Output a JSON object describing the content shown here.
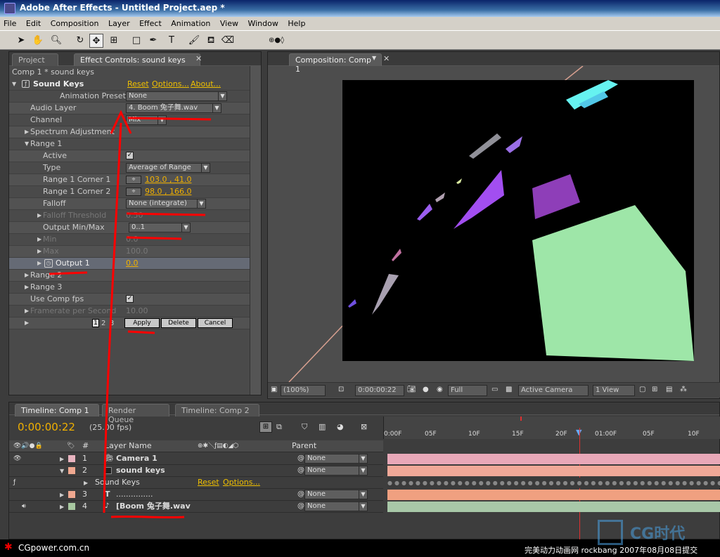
{
  "window": {
    "title": "Adobe After Effects - Untitled Project.aep *"
  },
  "menu": [
    "File",
    "Edit",
    "Composition",
    "Layer",
    "Effect",
    "Animation",
    "View",
    "Window",
    "Help"
  ],
  "left_panel": {
    "tabs": [
      "Project",
      "Effect Controls: sound keys"
    ],
    "breadcrumb": "Comp 1 * sound keys",
    "effect_name": "Sound Keys",
    "reset": "Reset",
    "options": "Options...",
    "about": "About...",
    "rows": [
      {
        "label": "Animation Presets:",
        "value": "None"
      },
      {
        "label": "Audio Layer",
        "value": "4. Boom 兔子舞.wav"
      },
      {
        "label": "Channel",
        "value": "Mix"
      },
      {
        "label": "Spectrum Adjustment",
        "value": ""
      },
      {
        "label": "Range 1",
        "value": ""
      },
      {
        "label": "Active",
        "value": "✓"
      },
      {
        "label": "Type",
        "value": "Average of Range"
      },
      {
        "label": "Range 1 Corner 1",
        "value": "103.0 , 41.0"
      },
      {
        "label": "Range 1 Corner 2",
        "value": "98.0 , 166.0"
      },
      {
        "label": "Falloff",
        "value": "None (integrate)"
      },
      {
        "label": "Falloff Threshold",
        "value": "0.50"
      },
      {
        "label": "Output Min/Max",
        "value": "0..1"
      },
      {
        "label": "Min",
        "value": "0.0"
      },
      {
        "label": "Max",
        "value": "100.0"
      },
      {
        "label": "Output 1",
        "value": "0.0"
      },
      {
        "label": "Range 2",
        "value": ""
      },
      {
        "label": "Range 3",
        "value": ""
      },
      {
        "label": "Use Comp fps",
        "value": "✓"
      },
      {
        "label": "Framerate per Second",
        "value": "10.00"
      }
    ],
    "pages": [
      "1",
      "2",
      "3"
    ],
    "buttons": {
      "apply": "Apply",
      "delete": "Delete",
      "cancel": "Cancel"
    }
  },
  "comp_panel": {
    "tab": "Composition: Comp 1",
    "zoom": "(100%)",
    "timecode": "0:00:00:22",
    "resolution": "Full",
    "camera": "Active Camera",
    "view": "1 View"
  },
  "timeline": {
    "tabs": [
      "Timeline: Comp 1",
      "Render Queue",
      "Timeline: Comp 2"
    ],
    "timecode": "0:00:00:22",
    "fps": "(25.00 fps)",
    "ruler": [
      "0:00F",
      "05F",
      "10F",
      "15F",
      "20F",
      "01:00F",
      "05F",
      "10F"
    ],
    "col_hash": "#",
    "col_layer_name": "Layer Name",
    "col_parent": "Parent",
    "layers": [
      {
        "num": "1",
        "name": "Camera 1",
        "parent": "None",
        "color": "#e8b4c0"
      },
      {
        "num": "2",
        "name": "sound keys",
        "parent": "None",
        "color": "#f0a890"
      },
      {
        "num": "",
        "name": "Sound Keys",
        "parent": "",
        "color": ""
      },
      {
        "num": "3",
        "name": "...............",
        "parent": "None",
        "color": "#f0a890"
      },
      {
        "num": "4",
        "name": "[Boom 兔子舞.wav",
        "parent": "None",
        "color": "#a8c8a0"
      }
    ],
    "sub_reset": "Reset",
    "sub_options": "Options..."
  },
  "footer": {
    "left": "CGpower.com.cn",
    "right": "完美动力动画网 rockbang 2007年08月08日提交",
    "watermark": "CG时代"
  },
  "colors": {
    "accent": "#f0c000",
    "annotation": "#ff0000"
  }
}
